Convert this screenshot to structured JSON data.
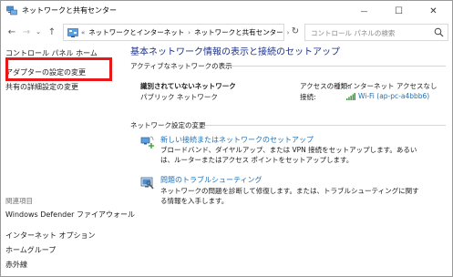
{
  "window": {
    "title": "ネットワークと共有センター",
    "minimize_glyph": "—",
    "maximize_glyph": "☐",
    "close_glyph": "✕"
  },
  "navigation": {
    "back_glyph": "←",
    "forward_glyph": "→",
    "recent_glyph": "⌄",
    "up_glyph": "↑",
    "breadcrumb_prefix": "«",
    "breadcrumbs": [
      "ネットワークとインターネット",
      "ネットワークと共有センター"
    ],
    "breadcrumb_separator": "›",
    "address_dropdown_glyph": "⌄",
    "refresh_glyph": "↻",
    "search_placeholder": "コントロール パネルの検索"
  },
  "left_pane": {
    "home": "コントロール パネル ホーム",
    "adapter_settings": "アダプターの設定の変更",
    "advanced_sharing": "共有の詳細設定の変更",
    "related_heading": "関連項目",
    "related": [
      "Windows Defender ファイアウォール",
      "インターネット オプション",
      "ホームグループ",
      "赤外線"
    ]
  },
  "main": {
    "title": "基本ネットワーク情報の表示と接続のセットアップ",
    "active_networks_heading": "アクティブなネットワークの表示",
    "network_name": "識別されていないネットワーク",
    "network_type": "パブリック ネットワーク",
    "access_type_label": "アクセスの種類:",
    "access_type_value": "インターネット アクセスなし",
    "connection_label": "接続:",
    "connection_value": "Wi-Fi (ap-pc-a4bbb6)",
    "change_settings_heading": "ネットワーク設定の変更",
    "tasks": [
      {
        "link": "新しい接続またはネットワークのセットアップ",
        "description": "ブロードバンド、ダイヤルアップ、または VPN 接続をセットアップします。あるいは、ルーターまたはアクセス ポイントをセットアップします。"
      },
      {
        "link": "問題のトラブルシューティング",
        "description": "ネットワークの問題を診断して修復します。または、トラブルシューティングに関する情報を入手します。"
      }
    ]
  },
  "colors": {
    "heading_blue": "#1e3287",
    "link_blue": "#1f6fb3",
    "highlight_red": "#e81818"
  }
}
